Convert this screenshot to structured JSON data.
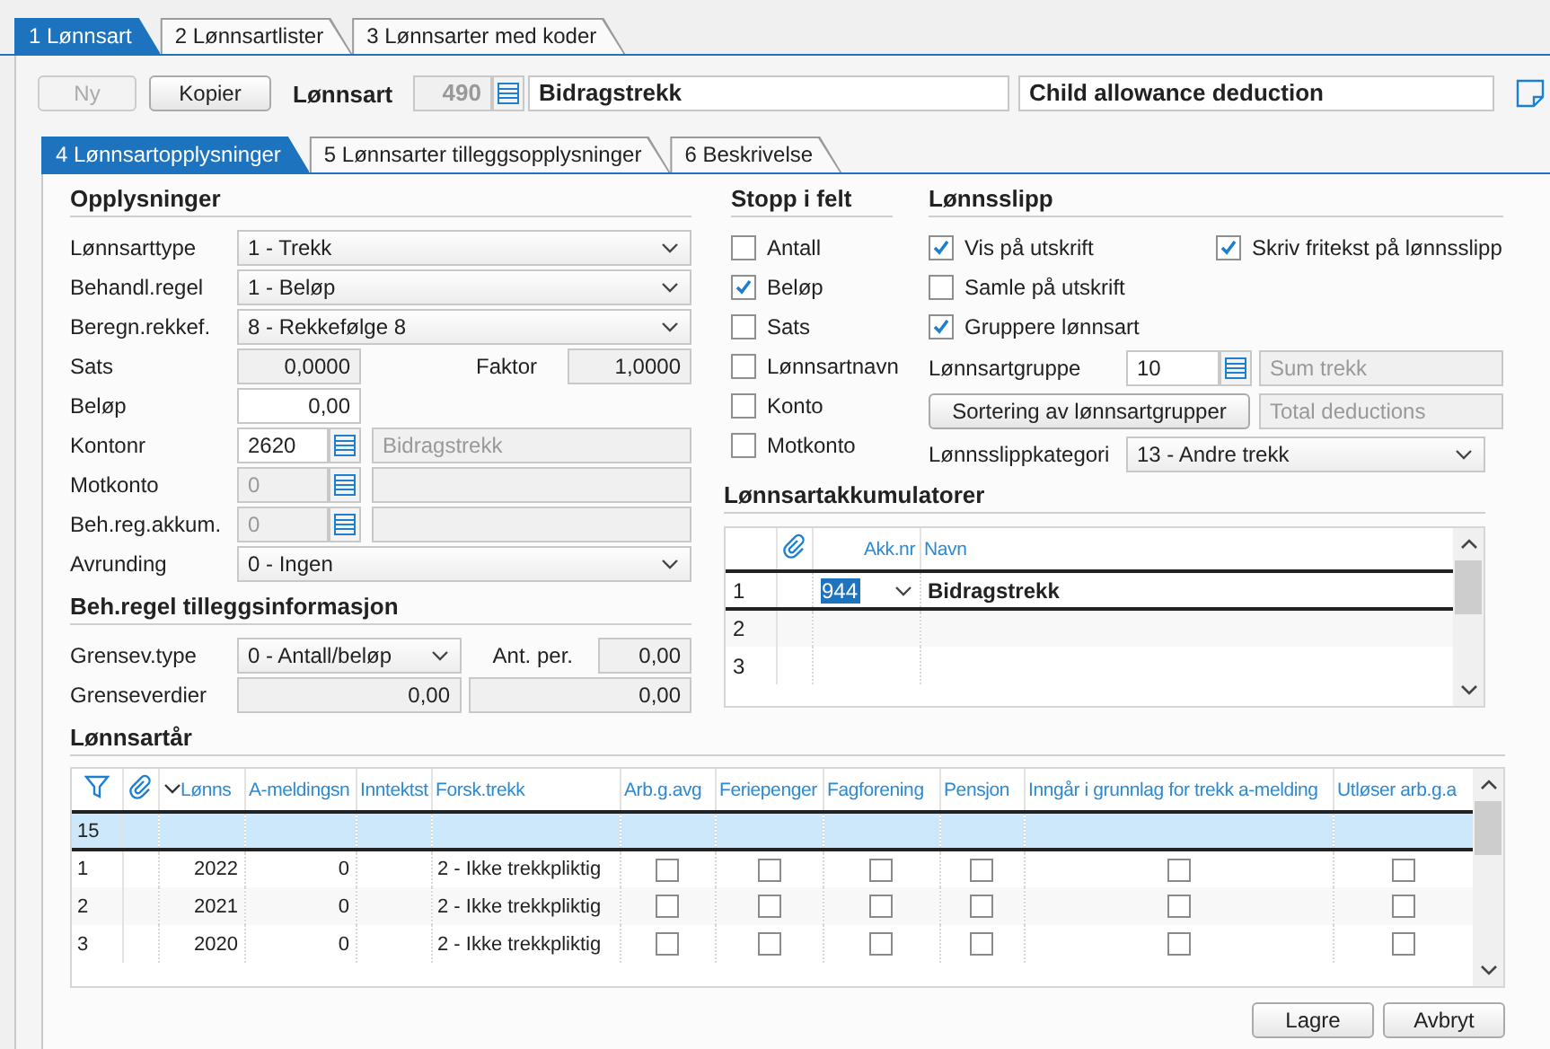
{
  "main_tabs": [
    {
      "label": "1 Lønnsart",
      "selected": true
    },
    {
      "label": "2 Lønnsartlister",
      "selected": false
    },
    {
      "label": "3 Lønnsarter med koder",
      "selected": false
    }
  ],
  "toolbar": {
    "buttons": [
      {
        "label": "Ny",
        "disabled": true
      },
      {
        "label": "Kopier",
        "disabled": false
      }
    ],
    "label": "Lønnsart",
    "code": {
      "value": "490",
      "disabled": true
    },
    "name": {
      "value": "Bidragstrekk",
      "disabled": false
    },
    "english_name": {
      "value": "Child allowance deduction",
      "disabled": false
    }
  },
  "sub_tabs": [
    {
      "label": "4 Lønnsartopplysninger",
      "selected": true
    },
    {
      "label": "5 Lønnsarter tilleggsopplysninger",
      "selected": false
    },
    {
      "label": "6 Beskrivelse",
      "selected": false
    }
  ],
  "opplysninger": {
    "title": "Opplysninger",
    "rows": [
      {
        "kind": "select",
        "label": "Lønnsarttype",
        "value": "1 - Trekk"
      },
      {
        "kind": "select",
        "label": "Behandl.regel",
        "value": "1 - Beløp"
      },
      {
        "kind": "select",
        "label": "Beregn.rekkef.",
        "value": "8 - Rekkefølge 8"
      },
      {
        "kind": "number",
        "label": "Sats",
        "field": {
          "value": "0,0000",
          "readonly": true
        },
        "extra_label": "Faktor",
        "extra_field": {
          "value": "1,0000",
          "readonly": true
        }
      },
      {
        "kind": "number",
        "label": "Beløp",
        "field": {
          "value": "0,00",
          "readonly": false
        }
      },
      {
        "kind": "lookup",
        "label": "Kontonr",
        "field": {
          "value": "2620",
          "disabled": false
        },
        "description": {
          "value": "Bidragstrekk",
          "disabled": true
        }
      },
      {
        "kind": "lookup",
        "label": "Motkonto",
        "field": {
          "value": "0",
          "disabled": true
        },
        "description": {
          "disabled": true
        }
      },
      {
        "kind": "lookup",
        "label": "Beh.reg.akkum.",
        "field": {
          "value": "0",
          "disabled": true
        },
        "description": {
          "disabled": true
        }
      },
      {
        "kind": "select",
        "label": "Avrunding",
        "value": "0 - Ingen"
      }
    ]
  },
  "tilleggsinformasjon": {
    "title": "Beh.regel tilleggsinformasjon",
    "rows": [
      {
        "kind": "short_select",
        "label": "Grensev.type",
        "value": "0 - Antall/beløp",
        "extra_label": "Ant. per.",
        "extra_field": {
          "value": "0,00",
          "readonly": true
        }
      },
      {
        "kind": "two_numbers",
        "label": "Grenseverdier",
        "fields": [
          {
            "value": "0,00",
            "readonly": true
          },
          {
            "value": "0,00",
            "readonly": true
          }
        ]
      }
    ]
  },
  "stopp_i_felt": {
    "title": "Stopp i felt",
    "items": [
      {
        "label": "Antall",
        "checked": false
      },
      {
        "label": "Beløp",
        "checked": true
      },
      {
        "label": "Sats",
        "checked": false
      },
      {
        "label": "Lønnsartnavn",
        "checked": false
      },
      {
        "label": "Konto",
        "checked": false
      },
      {
        "label": "Motkonto",
        "checked": false
      }
    ]
  },
  "lonnsslipp": {
    "title": "Lønnsslipp",
    "check_rows": [
      [
        {
          "label": "Vis på utskrift",
          "checked": true
        },
        {
          "label": "Skriv fritekst på lønnsslipp",
          "checked": true
        }
      ],
      [
        {
          "label": "Samle på utskrift",
          "checked": false
        }
      ],
      [
        {
          "label": "Gruppere lønnsart",
          "checked": true
        }
      ]
    ],
    "group": {
      "label": "Lønnsartgruppe",
      "field": {
        "value": "10",
        "disabled": false
      },
      "description": {
        "value": "Sum trekk",
        "disabled": true
      }
    },
    "sort_button": "Sortering av lønnsartgrupper",
    "sort_description": {
      "value": "Total deductions",
      "disabled": true
    },
    "category": {
      "label": "Lønnsslippkategori",
      "value": "13 - Andre trekk"
    }
  },
  "akkumulatorer": {
    "title": "Lønnsartakkumulatorer",
    "columns": [
      {
        "kind": "attachment"
      },
      {
        "kind": "text",
        "label": "Akk.nr"
      },
      {
        "kind": "text",
        "label": "Navn"
      }
    ],
    "rows": [
      {
        "number": "1",
        "akk_nr": "944",
        "name": "Bidragstrekk",
        "selected": true
      },
      {
        "number": "2",
        "selected": false
      },
      {
        "number": "3",
        "selected": false
      }
    ]
  },
  "lonnsartar": {
    "title": "Lønnsartår",
    "columns": [
      {
        "kind": "filter"
      },
      {
        "kind": "attachment"
      },
      {
        "kind": "text",
        "label": "Lønns",
        "sorted_descending": true
      },
      {
        "kind": "text",
        "label": "A-meldingsn"
      },
      {
        "kind": "text",
        "label": "Inntektst"
      },
      {
        "kind": "text",
        "label": "Forsk.trekk"
      },
      {
        "kind": "text",
        "label": "Arb.g.avg"
      },
      {
        "kind": "text",
        "label": "Feriepenger"
      },
      {
        "kind": "text",
        "label": "Fagforening"
      },
      {
        "kind": "text",
        "label": "Pensjon"
      },
      {
        "kind": "text",
        "label": "Inngår i grunnlag for trekk a-melding"
      },
      {
        "kind": "text",
        "label": "Utløser arb.g.a"
      }
    ],
    "rows": [
      {
        "number": "15",
        "selected": true
      },
      {
        "number": "1",
        "selected": false,
        "year": "2022",
        "a_melding": "0",
        "forsk_trekk": "2 - Ikke trekkpliktig",
        "flags": [
          {
            "checked": false
          },
          {
            "checked": false
          },
          {
            "checked": false
          },
          {
            "checked": false
          },
          {
            "checked": false
          },
          {
            "checked": false
          }
        ]
      },
      {
        "number": "2",
        "selected": false,
        "year": "2021",
        "a_melding": "0",
        "forsk_trekk": "2 - Ikke trekkpliktig",
        "flags": [
          {
            "checked": false
          },
          {
            "checked": false
          },
          {
            "checked": false
          },
          {
            "checked": false
          },
          {
            "checked": false
          },
          {
            "checked": false
          }
        ]
      },
      {
        "number": "3",
        "selected": false,
        "year": "2020",
        "a_melding": "0",
        "forsk_trekk": "2 - Ikke trekkpliktig",
        "flags": [
          {
            "checked": false
          },
          {
            "checked": false
          },
          {
            "checked": false
          },
          {
            "checked": false
          },
          {
            "checked": false
          },
          {
            "checked": false
          }
        ]
      }
    ]
  },
  "buttons": [
    "Lagre",
    "Avbryt"
  ]
}
